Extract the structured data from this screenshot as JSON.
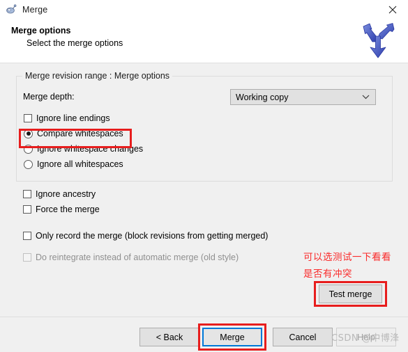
{
  "window": {
    "title": "Merge",
    "icon": "merge-app-icon",
    "close_label": "✕"
  },
  "header": {
    "title": "Merge options",
    "subtitle": "Select the merge options",
    "logo": "merge-arrow-logo"
  },
  "group": {
    "legend": "Merge revision range : Merge options",
    "merge_depth_label": "Merge depth:",
    "merge_depth_value": "Working copy",
    "merge_depth_arrow": "⌄",
    "options": [
      {
        "type": "checkbox",
        "label": "Ignore line endings",
        "checked": false,
        "enabled": true
      },
      {
        "type": "radio",
        "label": "Compare whitespaces",
        "checked": true,
        "enabled": true
      },
      {
        "type": "radio",
        "label": "Ignore whitespace changes",
        "checked": false,
        "enabled": true
      },
      {
        "type": "radio",
        "label": "Ignore all whitespaces",
        "checked": false,
        "enabled": true
      }
    ]
  },
  "extra_options": [
    {
      "type": "checkbox",
      "label": "Ignore ancestry",
      "checked": false,
      "enabled": true
    },
    {
      "type": "checkbox",
      "label": "Force the merge",
      "checked": false,
      "enabled": true
    },
    {
      "type": "checkbox",
      "label": "Only record the merge (block revisions from getting merged)",
      "checked": false,
      "enabled": true
    },
    {
      "type": "checkbox",
      "label": "Do reintegrate instead of automatic merge (old style)",
      "checked": false,
      "enabled": false
    }
  ],
  "annotations": {
    "line1": "可以选测试一下看看",
    "line2": "是否有冲突",
    "color": "#fa2a2a",
    "highlight_color": "#e71d1d"
  },
  "test_merge_button": "Test merge",
  "footer": {
    "buttons": [
      {
        "label": "< Back",
        "enabled": true,
        "focused": false
      },
      {
        "label": "Merge",
        "enabled": true,
        "focused": true
      },
      {
        "label": "Cancel",
        "enabled": true,
        "focused": false
      },
      {
        "label": "Help",
        "enabled": false,
        "focused": false
      }
    ]
  },
  "watermark": "CSDN @中博浲"
}
